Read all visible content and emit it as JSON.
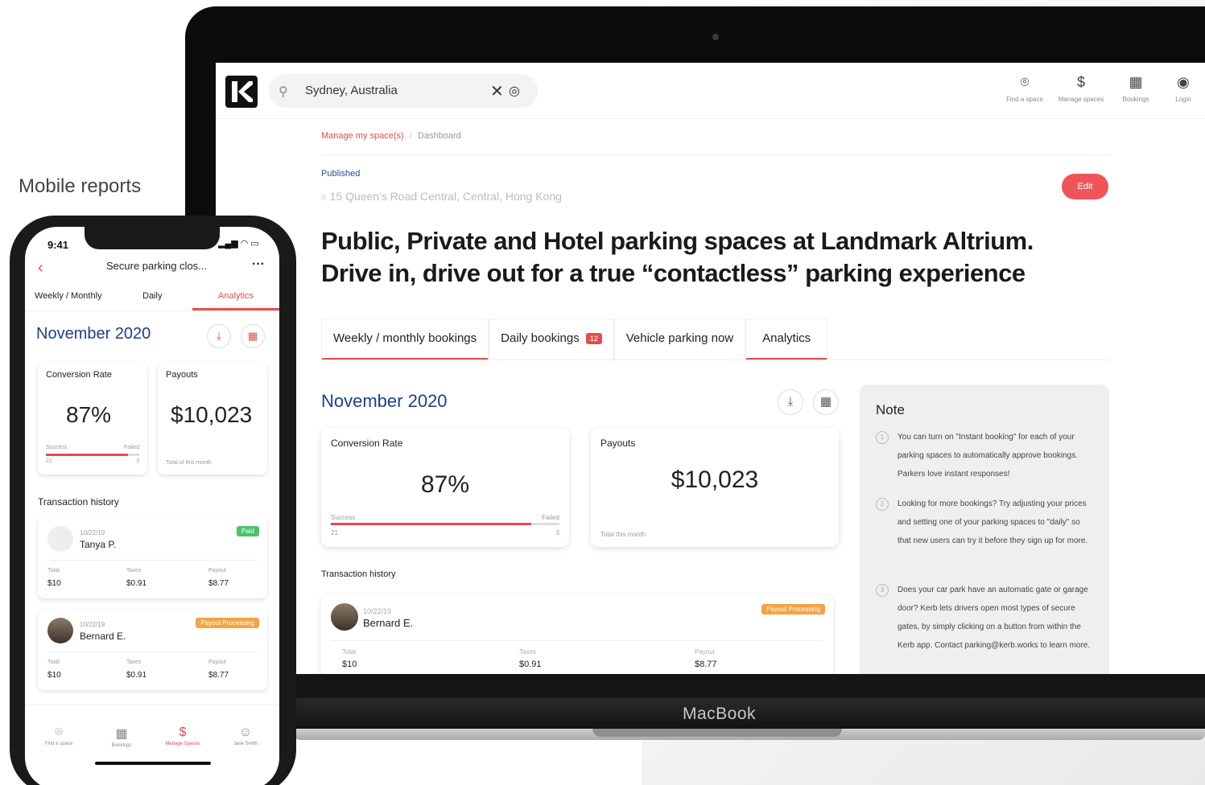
{
  "caption": "Mobile reports",
  "laptop_brand": "MacBook",
  "web": {
    "search": {
      "value": "Sydney, Australia"
    },
    "nav": [
      {
        "label": "Find a space",
        "icon": "map-pin-icon"
      },
      {
        "label": "Manage spaces",
        "icon": "dollar-circle-icon"
      },
      {
        "label": "Bookings",
        "icon": "calendar-icon"
      },
      {
        "label": "Login",
        "icon": "user-circle-icon"
      }
    ],
    "breadcrumb": {
      "active": "Manage my space(s)",
      "sep": "/",
      "current": "Dashboard"
    },
    "status": "Published",
    "address": "15 Queen's Road Central, Central, Hong Kong",
    "edit_label": "Edit",
    "title_line1": "Public, Private and Hotel parking spaces at Landmark Altrium.",
    "title_line2": "Drive in, drive out for a true “contactless” parking experience",
    "tabs": [
      {
        "label": "Weekly / monthly bookings",
        "selected": true
      },
      {
        "label": "Daily bookings",
        "badge": "12",
        "selected": false
      },
      {
        "label": "Vehicle parking now",
        "selected": false
      },
      {
        "label": "Analytics",
        "selected": true
      }
    ],
    "month": "November 2020",
    "conversion": {
      "title": "Conversion Rate",
      "value": "87%",
      "success_label": "Success",
      "failed_label": "Failed",
      "success_count": "21",
      "failed_count": "3",
      "success_fraction": 0.875
    },
    "payouts": {
      "title": "Payouts",
      "value": "$10,023",
      "caption": "Total this month"
    },
    "tx_title": "Transaction history",
    "transaction": {
      "date": "10/22/19",
      "name": "Bernard E.",
      "status": "Payout Processing",
      "total_label": "Total",
      "total": "$10",
      "taxes_label": "Taxes",
      "taxes": "$0.91",
      "payout_label": "Payout",
      "payout": "$8.77"
    },
    "note": {
      "title": "Note",
      "items": [
        {
          "num": "1",
          "text": "You can turn on \"Instant booking\" for each of your parking spaces to automatically approve bookings. Parkers love instant responses!"
        },
        {
          "num": "2",
          "text": "Looking for more bookings? Try adjusting your prices and setting one of your parking spaces to \"daily\" so that new users can try it before they sign up for more."
        },
        {
          "num": "3",
          "text": "Does your car park have an automatic gate or garage door? Kerb lets drivers open most types of secure gates, by simply clicking on a button from within the Kerb app. Contact parking@kerb.works to learn more."
        }
      ]
    }
  },
  "mobile": {
    "time": "9:41",
    "title": "Secure parking clos...",
    "tabs": [
      {
        "label": "Weekly / Monthly"
      },
      {
        "label": "Daily"
      },
      {
        "label": "Analytics"
      }
    ],
    "month": "November 2020",
    "conversion": {
      "title": "Conversion Rate",
      "value": "87%",
      "success_label": "Success",
      "failed_label": "Failed",
      "success_count": "21",
      "failed_count": "3"
    },
    "payouts": {
      "title": "Payouts",
      "value": "$10,023",
      "caption": "Total of this month"
    },
    "tx_title": "Transaction history",
    "transactions": [
      {
        "date": "10/22/19",
        "name": "Tanya P.",
        "status": "Paid",
        "status_color": "#4cc36a",
        "total_label": "Total",
        "total": "$10",
        "taxes_label": "Taxes",
        "taxes": "$0.91",
        "payout_label": "Payout",
        "payout": "$8.77"
      },
      {
        "date": "10/22/19",
        "name": "Bernard E.",
        "status": "Payout Processing",
        "status_color": "#f5a341",
        "total_label": "Total",
        "total": "$10",
        "taxes_label": "Taxes",
        "taxes": "$0.91",
        "payout_label": "Payout",
        "payout": "$8.77"
      }
    ],
    "nav": [
      {
        "label": "Find a space",
        "icon": "map-pin-icon"
      },
      {
        "label": "Bookings",
        "icon": "calendar-icon"
      },
      {
        "label": "Manage Spaces",
        "icon": "dollar-circle-icon"
      },
      {
        "label": "Jane Smith",
        "icon": "avatar-icon"
      }
    ]
  },
  "colors": {
    "accent": "#e84b4b",
    "brand_blue": "#1e3f8a",
    "processing": "#f5a341",
    "paid": "#4cc36a"
  }
}
